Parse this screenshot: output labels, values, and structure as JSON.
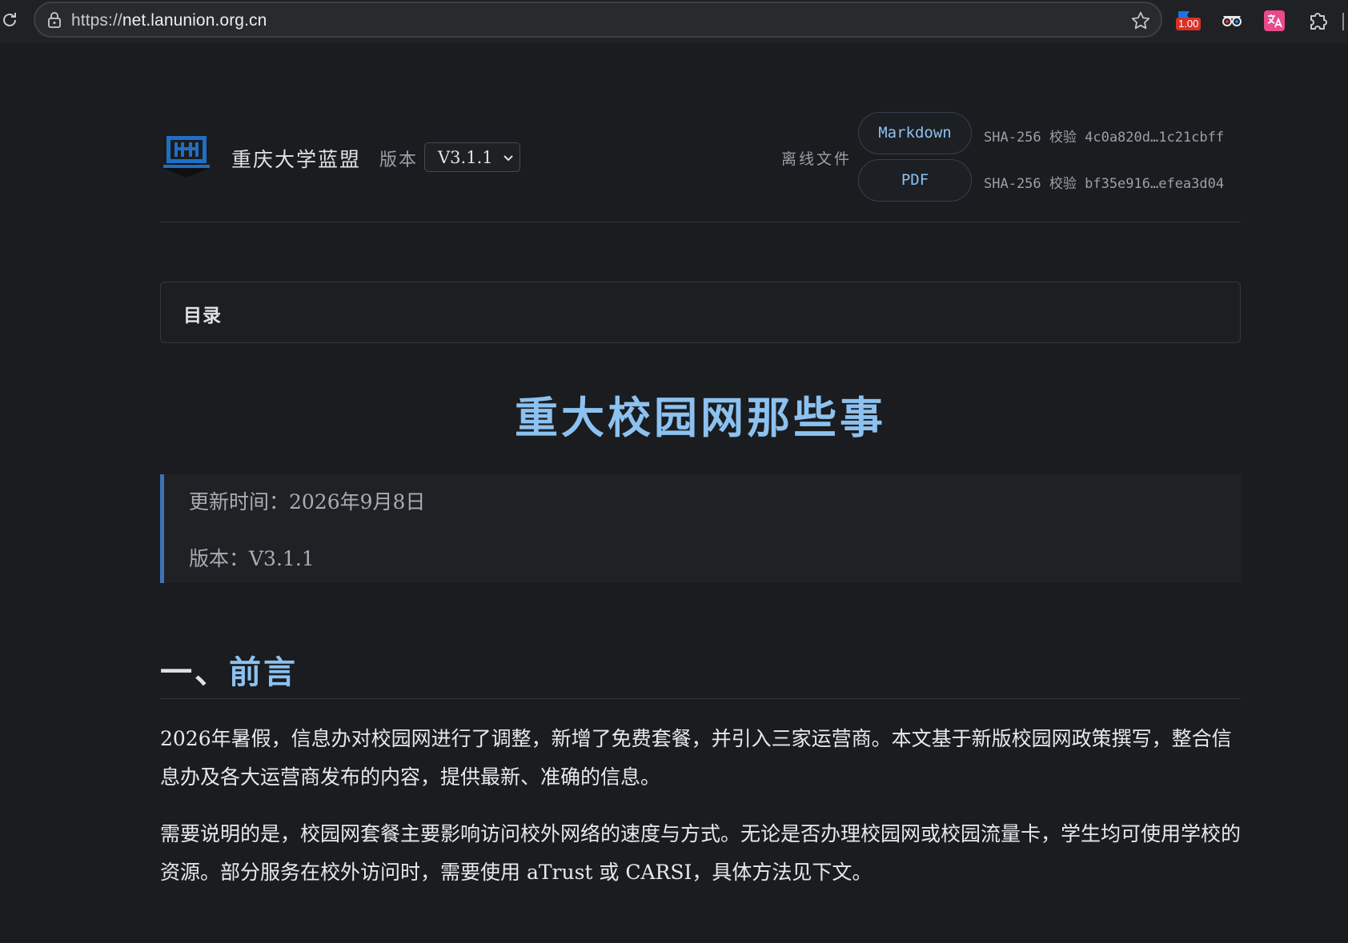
{
  "browser": {
    "url_scheme": "https://",
    "url_host": "net.lanunion.org.cn",
    "extension_badge": "1.00"
  },
  "header": {
    "site_name": "重庆大学蓝盟",
    "version_label": "版本",
    "version_value": "V3.1.1",
    "offline_label": "离线文件",
    "files": [
      {
        "label": "Markdown",
        "sha": "SHA-256 校验 4c0a820d…1c21cbff"
      },
      {
        "label": "PDF",
        "sha": "SHA-256 校验 bf35e916…efea3d04"
      }
    ]
  },
  "toc": {
    "label": "目录"
  },
  "document": {
    "title": "重大校园网那些事",
    "updated": "更新时间：2026年9月8日",
    "version": "版本：V3.1.1",
    "section1": {
      "prefix": "一、",
      "title": "前言"
    },
    "paragraphs": [
      "2026年暑假，信息办对校园网进行了调整，新增了免费套餐，并引入三家运营商。本文基于新版校园网政策撰写，整合信息办及各大运营商发布的内容，提供最新、准确的信息。",
      "需要说明的是，校园网套餐主要影响访问校外网络的速度与方式。无论是否办理校园网或校园流量卡，学生均可使用学校的资源。部分服务在校外访问时，需要使用 aTrust 或 CARSI，具体方法见下文。"
    ]
  },
  "colors": {
    "accent": "#8cc1f0",
    "background": "#1a1c1f",
    "quote_border": "#3d74b8"
  }
}
